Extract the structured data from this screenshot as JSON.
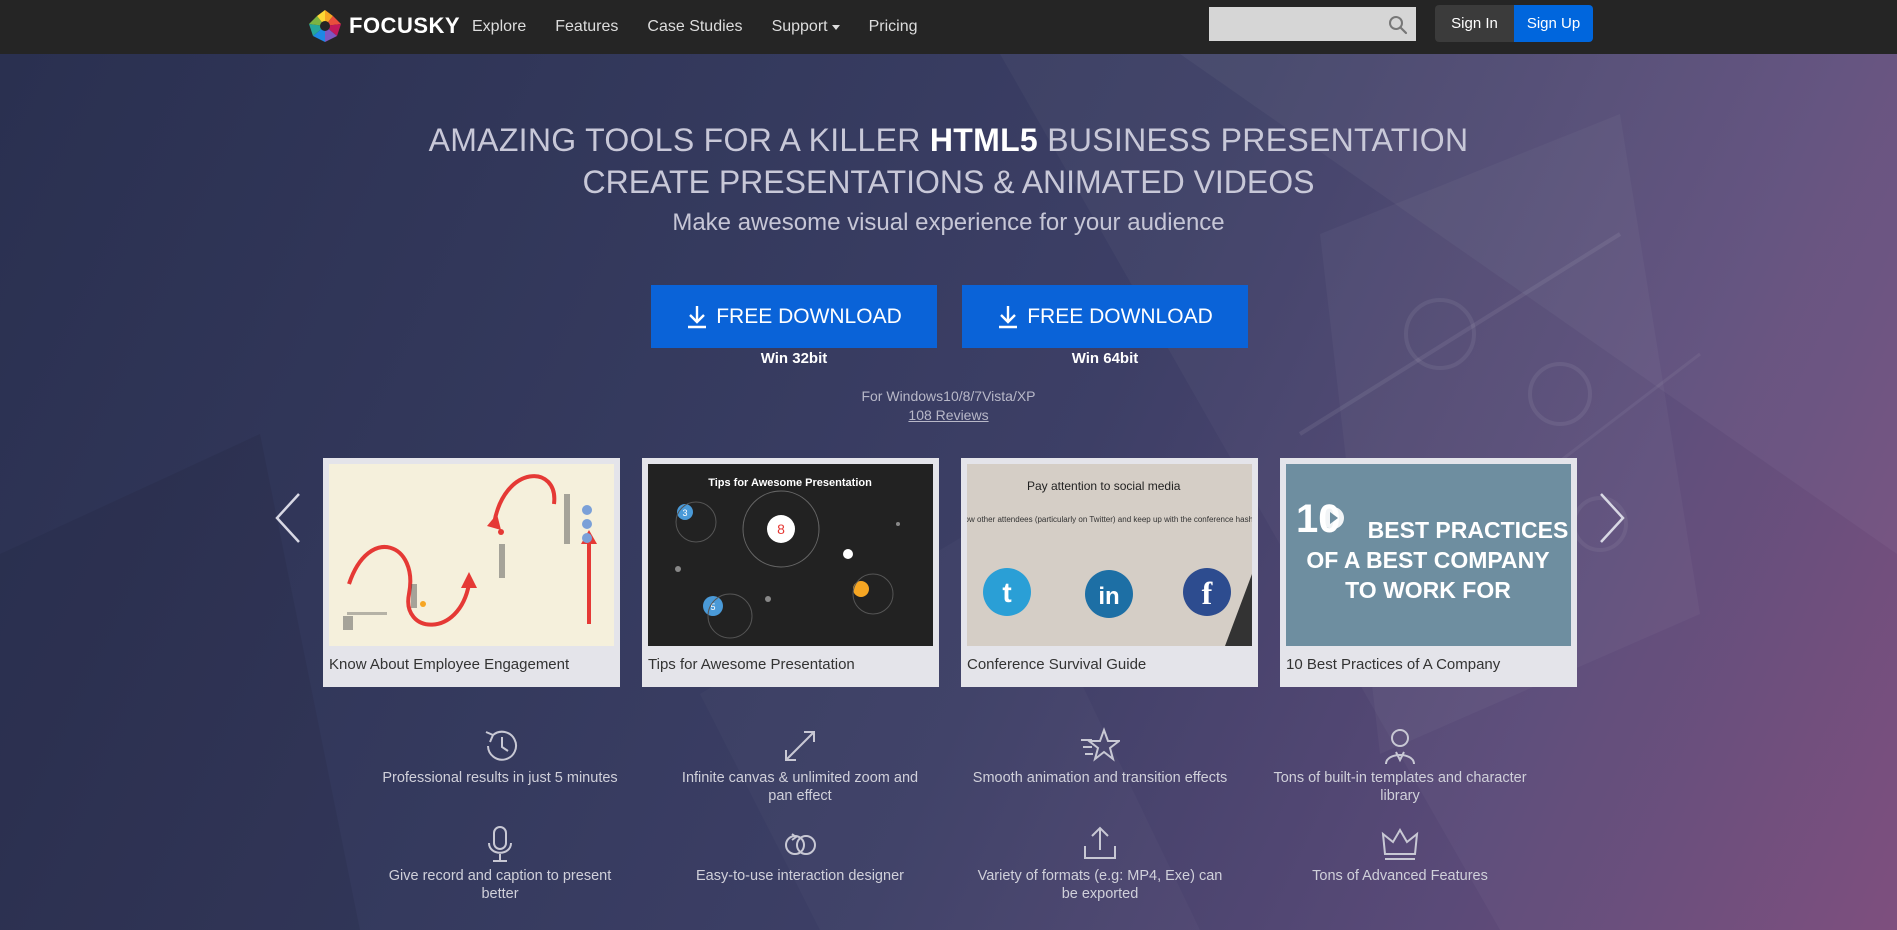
{
  "navbar": {
    "brand": "FOCUSKY",
    "links": [
      {
        "label": "Explore"
      },
      {
        "label": "Features"
      },
      {
        "label": "Case Studies"
      },
      {
        "label": "Support"
      },
      {
        "label": "Pricing"
      }
    ],
    "search_placeholder": "",
    "signin_label": "Sign In",
    "signup_label": "Sign Up"
  },
  "hero": {
    "headline_pre": "AMAZING TOOLS FOR A KILLER ",
    "headline_bold": "HTML5",
    "headline_post": " BUSINESS PRESENTATION",
    "subhead": "CREATE PRESENTATIONS & ANIMATED VIDEOS",
    "tagline": "Make awesome visual experience for your audience",
    "downloads": [
      {
        "label": "FREE DOWNLOAD",
        "sub": "Win 32bit"
      },
      {
        "label": "FREE DOWNLOAD",
        "sub": "Win 64bit"
      }
    ],
    "os_note": "For Windows10/8/7Vista/XP",
    "reviews": "108 Reviews"
  },
  "carousel": {
    "cards": [
      {
        "title": "Know About Employee Engagement"
      },
      {
        "title": "Tips for Awesome Presentation",
        "thumb_heading": "Tips for Awesome Presentation"
      },
      {
        "title": "Conference Survival Guide",
        "thumb_heading": "Pay attention to social media",
        "thumb_body": "Follow other attendees (particularly on Twitter) and keep up with the conference hashtag."
      },
      {
        "title": "10 Best Practices of A Company",
        "thumb_num": "10",
        "thumb_heading_1": "BEST PRACTICES",
        "thumb_heading_2": "OF A BEST COMPANY",
        "thumb_heading_3": "TO WORK FOR"
      }
    ]
  },
  "features": [
    {
      "icon": "clock-icon",
      "text": "Professional results in just 5 minutes"
    },
    {
      "icon": "expand-icon",
      "text": "Infinite canvas & unlimited zoom and pan effect"
    },
    {
      "icon": "star-icon",
      "text": "Smooth animation and transition effects"
    },
    {
      "icon": "character-icon",
      "text": "Tons of built-in templates and character library"
    },
    {
      "icon": "microphone-icon",
      "text": "Give record and caption to present better"
    },
    {
      "icon": "interaction-icon",
      "text": "Easy-to-use interaction designer"
    },
    {
      "icon": "export-icon",
      "text": "Variety of formats (e.g: MP4, Exe) can be exported"
    },
    {
      "icon": "crown-icon",
      "text": "Tons of Advanced Features"
    }
  ],
  "colors": {
    "nav_bg": "#252525",
    "accent": "#0a63d8",
    "signup": "#0066dd"
  }
}
